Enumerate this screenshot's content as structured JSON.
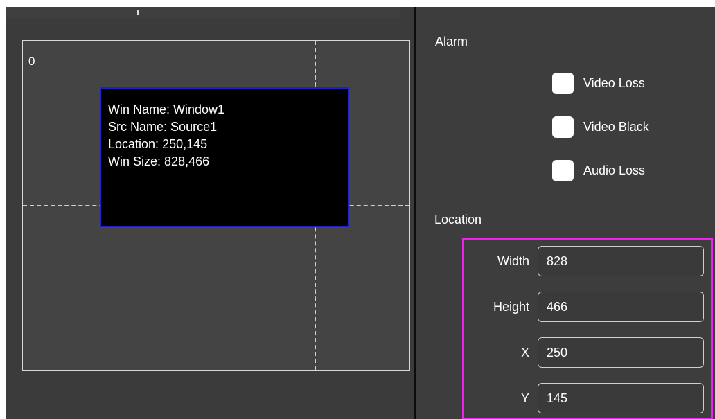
{
  "canvas": {
    "origin_label": "0",
    "window_info": {
      "win_name_label": "Win Name:",
      "win_name_value": "Window1",
      "src_name_label": "Src Name:",
      "src_name_value": "Source1",
      "location_label": "Location:",
      "location_value": "250,145",
      "win_size_label": "Win Size:",
      "win_size_value": "828,466"
    }
  },
  "alarm": {
    "title": "Alarm",
    "options": [
      {
        "label": "Video Loss",
        "checked": false
      },
      {
        "label": "Video Black",
        "checked": false
      },
      {
        "label": "Audio Loss",
        "checked": false
      }
    ]
  },
  "location": {
    "title": "Location",
    "fields": [
      {
        "label": "Width",
        "value": "828"
      },
      {
        "label": "Height",
        "value": "466"
      },
      {
        "label": "X",
        "value": "250"
      },
      {
        "label": "Y",
        "value": "145"
      }
    ]
  },
  "colors": {
    "highlight_border": "#ee22ee",
    "window_border": "#2020c8",
    "background": "#3a3a3a"
  }
}
